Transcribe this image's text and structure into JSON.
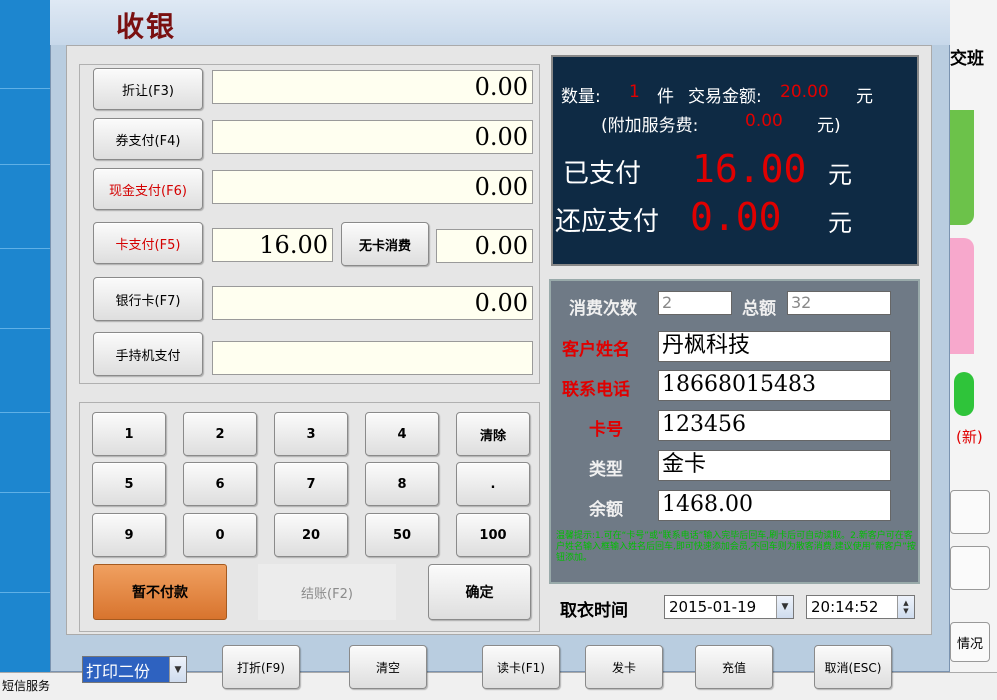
{
  "dialog": {
    "title": "收银"
  },
  "payments": {
    "discount": {
      "label": "折让(F3)",
      "value": "0.00"
    },
    "coupon": {
      "label": "券支付(F4)",
      "value": "0.00"
    },
    "cash": {
      "label": "现金支付(F6)",
      "value": "0.00"
    },
    "card": {
      "label": "卡支付(F5)",
      "value": "16.00",
      "no_card_label": "无卡消费",
      "no_card_value": "0.00"
    },
    "bank": {
      "label": "银行卡(F7)",
      "value": "0.00"
    },
    "handheld": {
      "label": "手持机支付",
      "value": ""
    }
  },
  "keypad": {
    "rows": [
      [
        "1",
        "2",
        "3",
        "4",
        "清除"
      ],
      [
        "5",
        "6",
        "7",
        "8",
        "."
      ],
      [
        "9",
        "0",
        "20",
        "50",
        "100"
      ]
    ],
    "defer": "暂不付款",
    "checkout": "结账(F2)",
    "confirm": "确定"
  },
  "summary": {
    "qty_label": "数量:",
    "qty": "1",
    "qty_unit": "件",
    "amount_label": "交易金额:",
    "amount": "20.00",
    "amount_unit": "元",
    "fee_prefix": "(附加服务费:",
    "fee": "0.00",
    "fee_suffix": "元)",
    "paid_label": "已支付",
    "paid": "16.00",
    "paid_unit": "元",
    "due_label": "还应支付",
    "due": "0.00",
    "due_unit": "元"
  },
  "customer": {
    "visits_label": "消费次数",
    "visits": "2",
    "total_label": "总额",
    "total": "32",
    "name_label": "客户姓名",
    "name": "丹枫科技",
    "phone_label": "联系电话",
    "phone": "18668015483",
    "card_label": "卡号",
    "card": "123456",
    "type_label": "类型",
    "type": "金卡",
    "balance_label": "余额",
    "balance": "1468.00",
    "tip": "温馨提示:1.可在“卡号”或“联系电话”输入完毕后回车,刷卡后可自动读取。2.新客户可在客户姓名输入框输入姓名后回车,即可快速添加会员,不回车则为散客消费,建议使用“新客户”按钮添加。"
  },
  "pickup": {
    "label": "取衣时间",
    "date": "2015-01-19",
    "time": "20:14:52"
  },
  "bottom": {
    "print_option": "打印二份",
    "buttons": [
      "打折(F9)",
      "清空",
      "读卡(F1)",
      "发卡",
      "充值",
      "取消(ESC)"
    ]
  },
  "background": {
    "right_labels": [
      "交班",
      "(新)",
      "情况"
    ],
    "status_text": "短信服务"
  }
}
